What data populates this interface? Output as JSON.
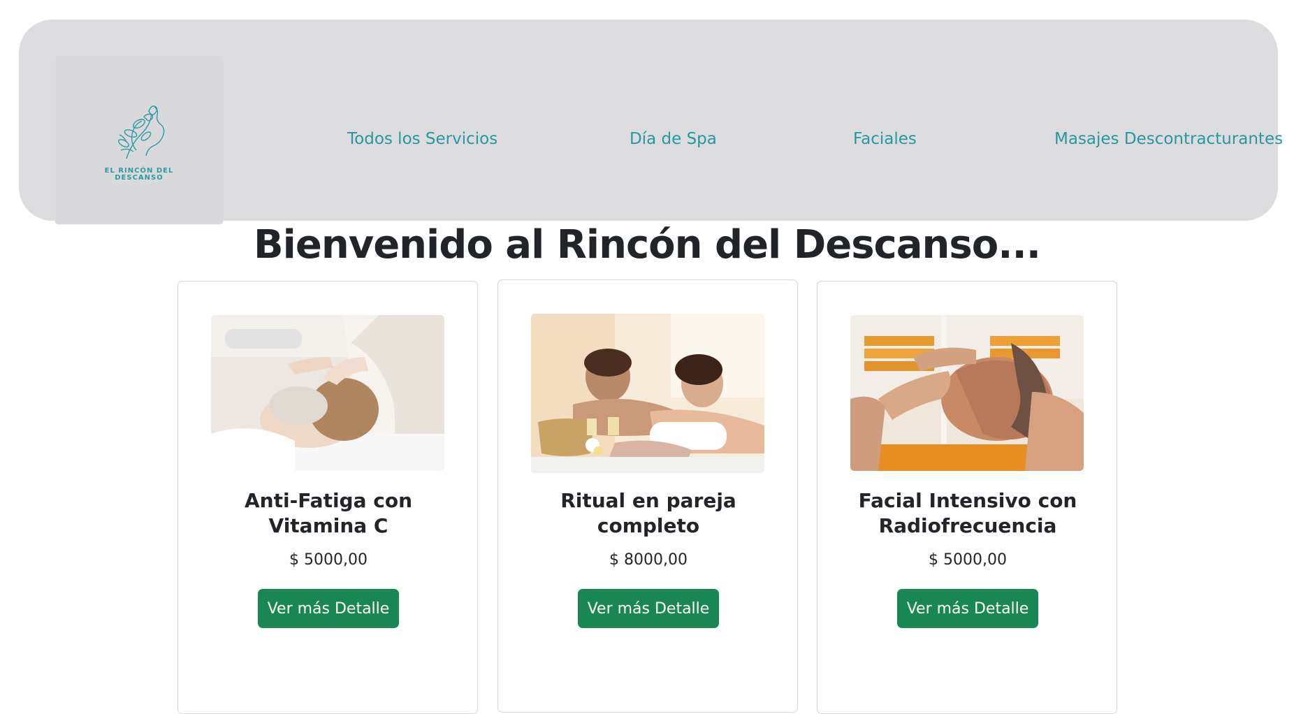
{
  "brand": {
    "logo_line1": "EL RINCÓN DEL",
    "logo_line2": "DESCANSO",
    "accent_color": "#27989f"
  },
  "nav": {
    "items": [
      {
        "label": "Todos los Servicios"
      },
      {
        "label": "Día de Spa"
      },
      {
        "label": "Faciales"
      },
      {
        "label": "Masajes Descontracturantes"
      }
    ]
  },
  "main": {
    "heading": "Bienvenido al Rincón del Descanso...",
    "cards": [
      {
        "title_line1": "Anti-Fatiga con",
        "title_line2": "Vitamina C",
        "price": "$ 5000,00",
        "button": "Ver más Detalle",
        "image": "facial-treatment-photo"
      },
      {
        "title_line1": "Ritual en pareja",
        "title_line2": "completo",
        "price": "$ 8000,00",
        "button": "Ver más Detalle",
        "image": "couple-massage-photo"
      },
      {
        "title_line1": "Facial Intensivo con",
        "title_line2": "Radiofrecuencia",
        "price": "$ 5000,00",
        "button": "Ver más Detalle",
        "image": "face-massage-photo"
      }
    ],
    "button_color": "#198754"
  }
}
